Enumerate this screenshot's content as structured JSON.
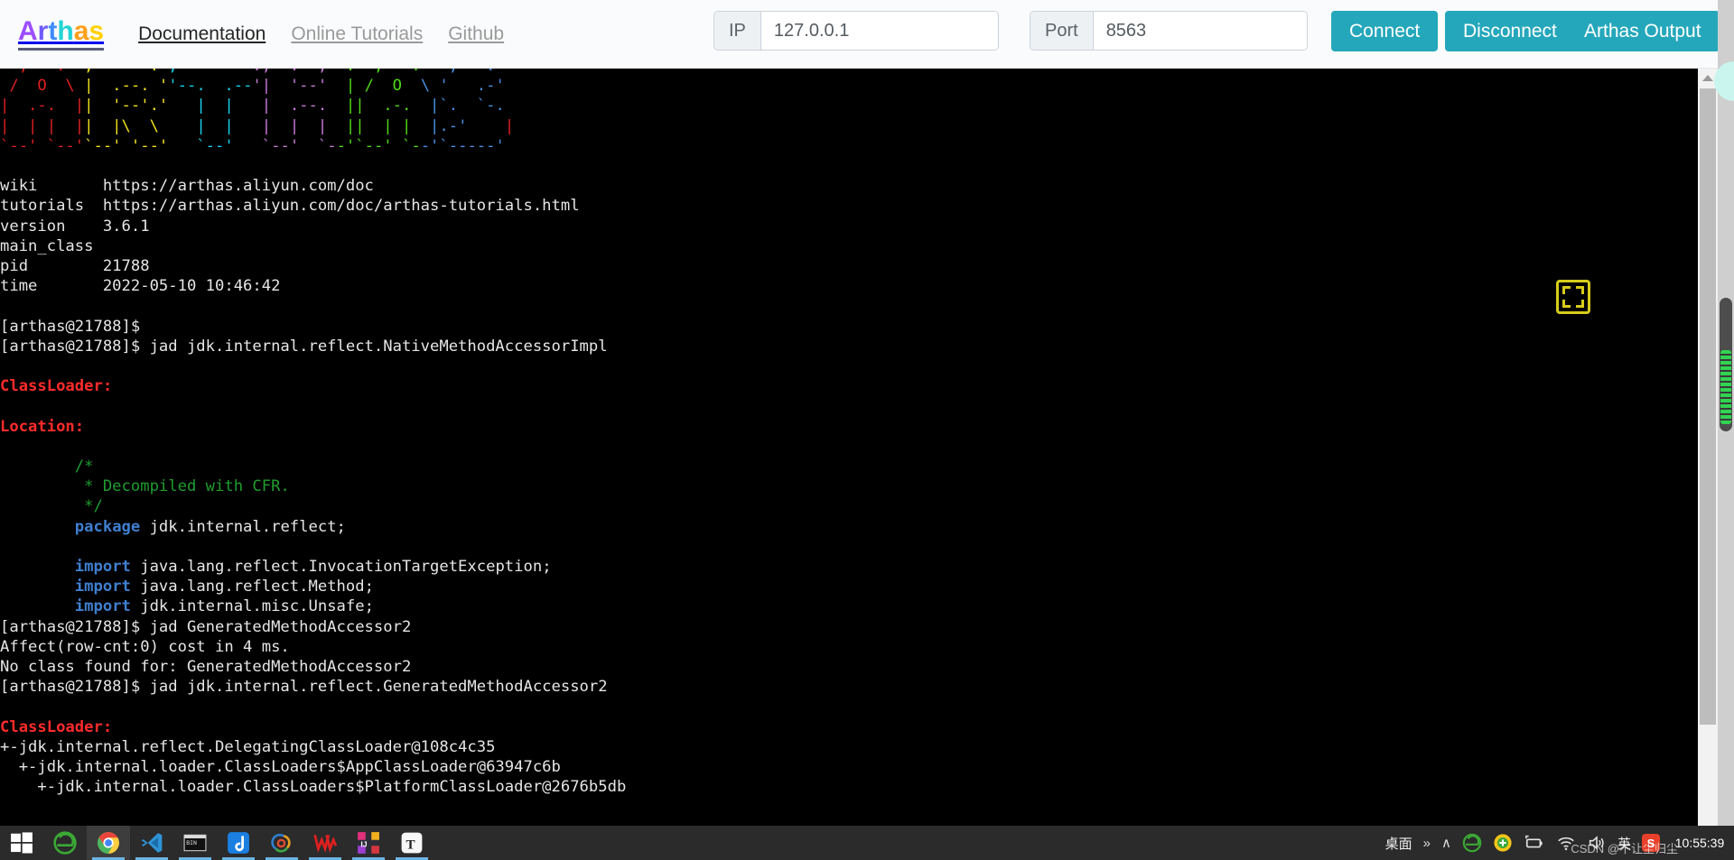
{
  "header": {
    "brand_text": "Arthas",
    "brand_letters": [
      {
        "ch": "A",
        "color": "#9b4dff"
      },
      {
        "ch": "r",
        "color": "#6f5bff"
      },
      {
        "ch": "t",
        "color": "#3f8cff"
      },
      {
        "ch": "h",
        "color": "#21d4d4"
      },
      {
        "ch": "a",
        "color": "#ff9f1a"
      },
      {
        "ch": "s",
        "color": "#ffd100"
      }
    ],
    "nav": [
      {
        "label": "Documentation",
        "active": true
      },
      {
        "label": "Online Tutorials",
        "active": false
      },
      {
        "label": "Github",
        "active": false
      }
    ],
    "ip_label": "IP",
    "ip_value": "127.0.0.1",
    "ip_placeholder": "127.0.0.1",
    "port_label": "Port",
    "port_value": "8563",
    "port_placeholder": "8563",
    "connect_label": "Connect",
    "disconnect_label": "Disconnect",
    "output_label": "Arthas Output",
    "accent_color": "#25a7bb"
  },
  "terminal": {
    "background": "#000000",
    "foreground": "#e6e6e6",
    "error_color": "#ff2b2b",
    "comment_color": "#1f9d2f",
    "keyword_color": "#3f7fd0",
    "banner_lines": [
      ",---.  ,------. ,--------.,--.  ,--.  ,---.   ,---.",
      "/  O  \\ |  .--. ''--.  .--'|  '--'  | /  O  \\ '   .-'",
      "|  .-.  ||  '--'.'   |  |   |  .--.  ||  .-.  |`.  `-.",
      "|  | |  ||  |\\  \\    |  |   |  |  |  ||  | |  |.-'    |",
      "`--' `--'`--' '--'   `--'   `--'  `--'`--' `--'`-----'"
    ],
    "info": [
      {
        "key": "wiki",
        "value": "https://arthas.aliyun.com/doc"
      },
      {
        "key": "tutorials",
        "value": "https://arthas.aliyun.com/doc/arthas-tutorials.html"
      },
      {
        "key": "version",
        "value": "3.6.1"
      },
      {
        "key": "main_class",
        "value": ""
      },
      {
        "key": "pid",
        "value": "21788"
      },
      {
        "key": "time",
        "value": "2022-05-10 10:46:42"
      }
    ],
    "prompt": "[arthas@21788]$",
    "commands": [
      "jad jdk.internal.reflect.NativeMethodAccessorImpl",
      "jad GeneratedMethodAccessor2",
      "jad jdk.internal.reflect.GeneratedMethodAccessor2"
    ],
    "labels": {
      "classloader": "ClassLoader:",
      "location": "Location:"
    },
    "code_lines": [
      "        /*",
      "         * Decompiled with CFR.",
      "         */",
      "        package jdk.internal.reflect;",
      "",
      "        import java.lang.reflect.InvocationTargetException;",
      "        import java.lang.reflect.Method;",
      "        import jdk.internal.misc.Unsafe;"
    ],
    "code_comment_1": "        /*",
    "code_comment_2": "         * Decompiled with CFR.",
    "code_comment_3": "         */",
    "code_package_kw": "package",
    "code_package_rest": " jdk.internal.reflect;",
    "code_import_kw": "import",
    "code_import_1": " java.lang.reflect.InvocationTargetException;",
    "code_import_2": " java.lang.reflect.Method;",
    "code_import_3": " jdk.internal.misc.Unsafe;",
    "affect_line": "Affect(row-cnt:0) cost in 4 ms.",
    "no_class_line": "No class found for: GeneratedMethodAccessor2",
    "classloader_tree": [
      "+-jdk.internal.reflect.DelegatingClassLoader@108c4c35",
      "  +-jdk.internal.loader.ClassLoaders$AppClassLoader@63947c6b",
      "    +-jdk.internal.loader.ClassLoaders$PlatformClassLoader@2676b5db"
    ],
    "fullscreen_icon": "fullscreen-icon"
  },
  "taskbar": {
    "items": [
      {
        "name": "start-button",
        "label": "Start",
        "active": false,
        "running": false
      },
      {
        "name": "edge-icon",
        "label": "Microsoft Edge",
        "active": false,
        "running": true
      },
      {
        "name": "chrome-icon",
        "label": "Google Chrome",
        "active": true,
        "running": true
      },
      {
        "name": "vscode-icon",
        "label": "Visual Studio Code",
        "active": false,
        "running": true
      },
      {
        "name": "terminal-icon",
        "label": "Command Prompt",
        "active": false,
        "running": true
      },
      {
        "name": "dingtalk-icon",
        "label": "DingTalk",
        "active": false,
        "running": true
      },
      {
        "name": "navicat-icon",
        "label": "Navicat",
        "active": false,
        "running": true
      },
      {
        "name": "wps-icon",
        "label": "WPS Office",
        "active": false,
        "running": true
      },
      {
        "name": "intellij-icon",
        "label": "IntelliJ IDEA",
        "active": false,
        "running": true
      },
      {
        "name": "typora-icon",
        "label": "Typora",
        "active": false,
        "running": true
      }
    ],
    "tray": {
      "desktop_label": "桌面",
      "overflow_chevron": "»",
      "up_chevron": "∧",
      "ime_label": "英",
      "sogou_label": "S",
      "time": "10:55:39",
      "watermark": "CSDN @不让尘归尘"
    }
  }
}
